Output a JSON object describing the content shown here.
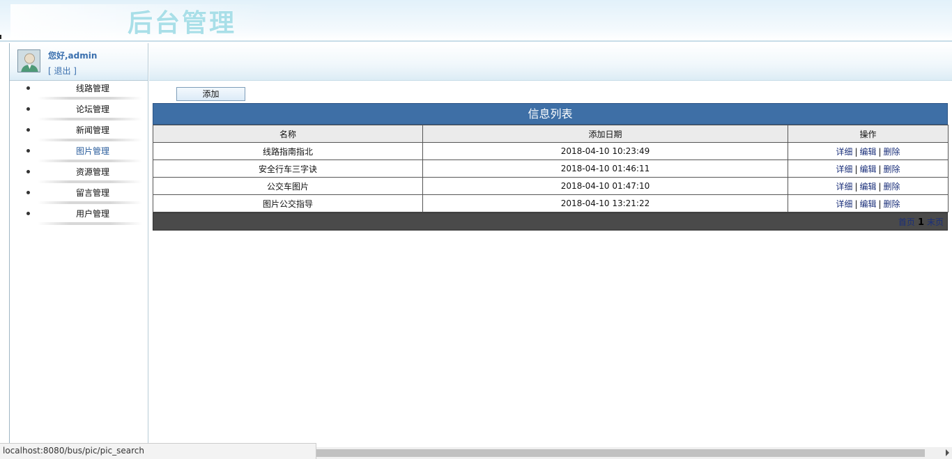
{
  "header": {
    "title": "后台管理"
  },
  "user": {
    "greeting": "您好,admin",
    "logout": "[ 退出 ]"
  },
  "menu": [
    {
      "label": "线路管理"
    },
    {
      "label": "论坛管理"
    },
    {
      "label": "新闻管理"
    },
    {
      "label": "图片管理",
      "active": true
    },
    {
      "label": "资源管理"
    },
    {
      "label": "留言管理"
    },
    {
      "label": "用户管理"
    }
  ],
  "toolbar": {
    "add_label": "添加"
  },
  "table": {
    "title": "信息列表",
    "columns": [
      "名称",
      "添加日期",
      "操作"
    ],
    "rows": [
      {
        "name": "线路指南指北",
        "date": "2018-04-10 10:23:49"
      },
      {
        "name": "安全行车三字诀",
        "date": "2018-04-10 01:46:11"
      },
      {
        "name": "公交车图片",
        "date": "2018-04-10 01:47:10"
      },
      {
        "name": "图片公交指导",
        "date": "2018-04-10 13:21:22"
      }
    ],
    "actions": {
      "detail": "详细",
      "edit": "编辑",
      "delete": "删除",
      "separator": "|"
    }
  },
  "pager": {
    "first": "首页",
    "current": "1",
    "last": "末页"
  },
  "status": {
    "url": "localhost:8080/bus/pic/pic_search"
  },
  "colors": {
    "table_header": "#3e6fa6",
    "title": "#a9dfe8",
    "link": "#1a2f7a"
  }
}
